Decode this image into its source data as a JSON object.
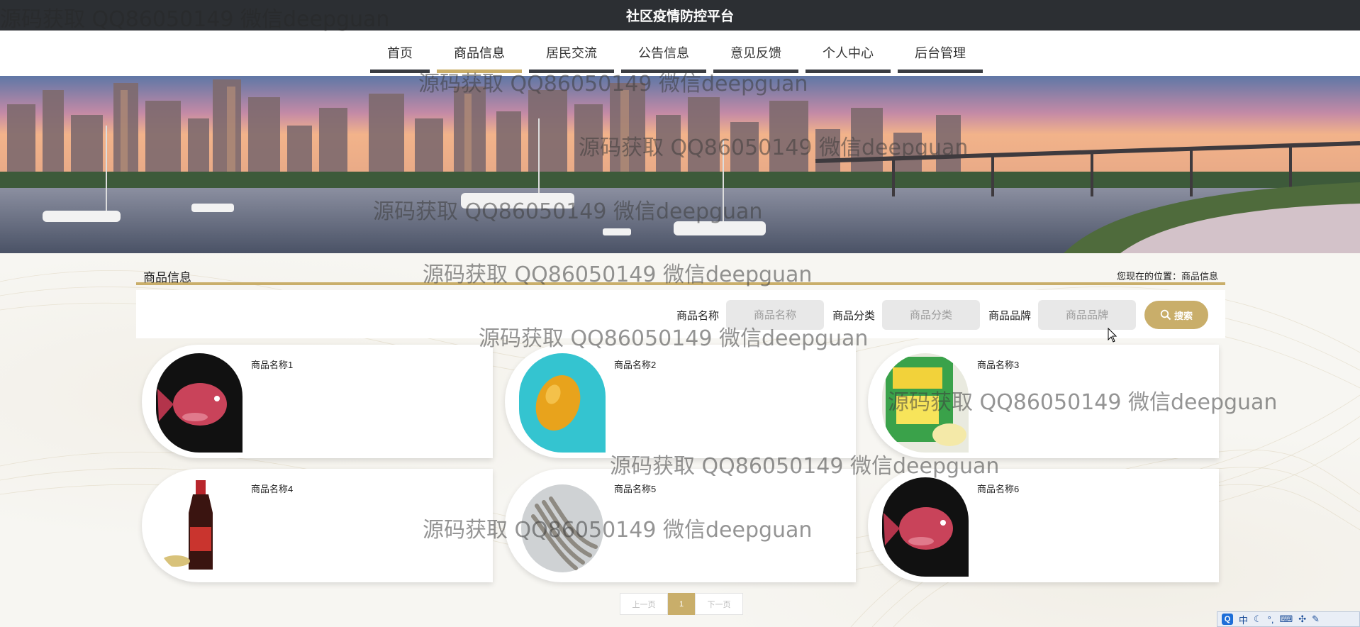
{
  "site": {
    "title": "社区疫情防控平台"
  },
  "nav": {
    "items": [
      {
        "label": "首页"
      },
      {
        "label": "商品信息"
      },
      {
        "label": "居民交流"
      },
      {
        "label": "公告信息"
      },
      {
        "label": "意见反馈"
      },
      {
        "label": "个人中心"
      },
      {
        "label": "后台管理"
      }
    ],
    "active": "商品信息"
  },
  "section": {
    "title": "商品信息",
    "breadcrumb": "您现在的位置：商品信息"
  },
  "search": {
    "name_label": "商品名称",
    "name_placeholder": "商品名称",
    "category_label": "商品分类",
    "category_placeholder": "商品分类",
    "brand_label": "商品品牌",
    "brand_placeholder": "商品品牌",
    "button_label": "搜索"
  },
  "products": [
    {
      "name": "商品名称1",
      "image": "red-arowana-fish"
    },
    {
      "name": "商品名称2",
      "image": "lemon"
    },
    {
      "name": "商品名称3",
      "image": "seasoning-package"
    },
    {
      "name": "商品名称4",
      "image": "soy-sauce-bottle"
    },
    {
      "name": "商品名称5",
      "image": "shrimp-plate"
    },
    {
      "name": "商品名称6",
      "image": "red-arowana-fish"
    }
  ],
  "pagination": {
    "prev": "上一页",
    "current": "1",
    "next": "下一页"
  },
  "watermark": {
    "text": "源码获取 QQ86050149 微信deepguan"
  },
  "tray": {
    "ime": "中"
  },
  "colors": {
    "accent": "#c9ae6a",
    "topbar": "#2c2f33",
    "nav_underline": "#3a3d42"
  }
}
